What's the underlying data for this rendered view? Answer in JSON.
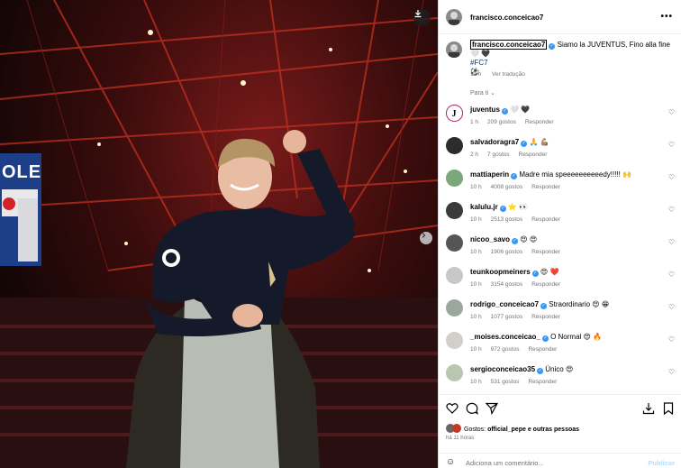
{
  "post": {
    "board_text": "OLE",
    "download_icon": "download-icon",
    "next_icon": "chevron-right-icon"
  },
  "header": {
    "username": "francisco.conceicao7",
    "more_icon": "more-icon"
  },
  "caption": {
    "username": "francisco.conceicao7",
    "text": "Siamo la JUVENTUS, Fino alla fine 🤍 🖤",
    "hashtag": "#FC7",
    "emoji": "⚽",
    "time": "11 h",
    "translate": "Ver tradução"
  },
  "section_label": "Para ti ⌄",
  "comments": [
    {
      "user": "juventus",
      "verified": true,
      "text": "🤍 🖤",
      "time": "1 h",
      "likes": "209 gostos",
      "reply": "Responder"
    },
    {
      "user": "salvadoragra7",
      "verified": true,
      "text": "🙏 💪🏽",
      "time": "2 h",
      "likes": "7 gostos",
      "reply": "Responder"
    },
    {
      "user": "mattiaperin",
      "verified": true,
      "text": "Madre mia speeeeeeeeeedy!!!!! 🙌",
      "time": "10 h",
      "likes": "4008 gostos",
      "reply": "Responder"
    },
    {
      "user": "kalulu.jr",
      "verified": true,
      "text": "⭐ 👀",
      "time": "10 h",
      "likes": "2513 gostos",
      "reply": "Responder"
    },
    {
      "user": "nicoo_savo",
      "verified": true,
      "text": "😍 😍",
      "time": "10 h",
      "likes": "1906 gostos",
      "reply": "Responder"
    },
    {
      "user": "teunkoopmeiners",
      "verified": true,
      "text": "😍 ❤️",
      "time": "10 h",
      "likes": "3154 gostos",
      "reply": "Responder"
    },
    {
      "user": "rodrigo_conceicao7",
      "verified": true,
      "text": "Straordinario 😍 😁",
      "time": "10 h",
      "likes": "1077 gostos",
      "reply": "Responder"
    },
    {
      "user": "_moises.conceicao_",
      "verified": true,
      "text": "O Normal 😍 🔥",
      "time": "10 h",
      "likes": "972 gostos",
      "reply": "Responder"
    },
    {
      "user": "sergioconceicao35",
      "verified": true,
      "text": "Único 😍",
      "time": "10 h",
      "likes": "531 gostos",
      "reply": "Responder"
    }
  ],
  "actions": {
    "likes_prefix": "Gostos:",
    "likes_user": "official_pepe",
    "likes_suffix": "e outras pessoas",
    "time": "há 11 horas"
  },
  "add_comment": {
    "placeholder": "Adiciona um comentário...",
    "publish": "Publicar"
  },
  "colors": {
    "verified": "#3897f0",
    "muted": "#737373",
    "publish": "#b2dffc"
  }
}
